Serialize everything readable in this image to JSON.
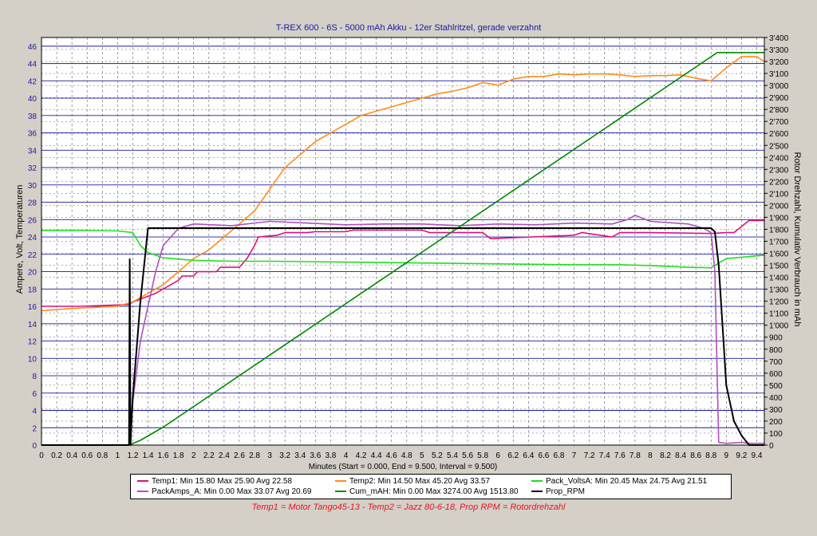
{
  "chart_data": {
    "type": "line",
    "title": "T-REX 600 - 6S - 5000 mAh Akku - 12er Stahlritzel, gerade verzahnt",
    "xlabel": "Minutes (Start = 0.000,  End = 9.500,  Interval =  9.500)",
    "ylabel_left": "Ampere, Volt, Temperaturen",
    "ylabel_right": "Rotor Drehzahl, Kumulativ Verbrauch in mAh",
    "xlim": [
      0,
      9.5
    ],
    "ylim_left": [
      0,
      47
    ],
    "ylim_right": [
      0,
      3400
    ],
    "grid": true,
    "x_ticks": [
      "0",
      "0.2",
      "0.4",
      "0.6",
      "0.8",
      "1",
      "1.2",
      "1.4",
      "1.6",
      "1.8",
      "2",
      "2.2",
      "2.4",
      "2.6",
      "2.8",
      "3",
      "3.2",
      "3.4",
      "3.6",
      "3.8",
      "4",
      "4.2",
      "4.4",
      "4.6",
      "4.8",
      "5",
      "5.2",
      "5.4",
      "5.6",
      "5.8",
      "6",
      "6.2",
      "6.4",
      "6.6",
      "6.8",
      "7",
      "7.2",
      "7.4",
      "7.6",
      "7.8",
      "8",
      "8.2",
      "8.4",
      "8.6",
      "8.8",
      "9",
      "9.2",
      "9.4"
    ],
    "y_left_ticks": [
      "0",
      "2",
      "4",
      "6",
      "8",
      "10",
      "12",
      "14",
      "16",
      "18",
      "20",
      "22",
      "24",
      "26",
      "28",
      "30",
      "32",
      "34",
      "36",
      "38",
      "40",
      "42",
      "44",
      "46"
    ],
    "y_right_ticks": [
      "0",
      "100",
      "200",
      "300",
      "400",
      "500",
      "600",
      "700",
      "800",
      "900",
      "1'000",
      "1'100",
      "1'200",
      "1'300",
      "1'400",
      "1'500",
      "1'600",
      "1'700",
      "1'800",
      "1'900",
      "2'000",
      "2'100",
      "2'200",
      "2'300",
      "2'400",
      "2'500",
      "2'600",
      "2'700",
      "2'800",
      "2'900",
      "3'000",
      "3'100",
      "3'200",
      "3'300",
      "3'400"
    ],
    "series": [
      {
        "name": "Temp1",
        "axis": "left",
        "color": "#e0107a",
        "x": [
          0,
          0.5,
          1.15,
          1.2,
          1.5,
          1.6,
          1.8,
          1.85,
          2.0,
          2.05,
          2.3,
          2.35,
          2.6,
          2.7,
          2.8,
          2.85,
          3.1,
          3.2,
          3.5,
          3.6,
          4.0,
          4.1,
          5.0,
          5.1,
          5.8,
          5.9,
          7.0,
          7.1,
          7.5,
          7.6,
          7.7,
          8.0,
          8.8,
          9.0,
          9.1,
          9.3,
          9.5
        ],
        "y": [
          16.0,
          16.0,
          16.2,
          16.5,
          17.5,
          18.0,
          19.0,
          19.5,
          19.5,
          20.0,
          20.0,
          20.5,
          20.5,
          21.5,
          23.0,
          24.0,
          24.2,
          24.5,
          24.5,
          24.6,
          24.6,
          24.8,
          24.8,
          24.5,
          24.5,
          23.8,
          24.2,
          24.5,
          24.0,
          24.5,
          24.5,
          24.5,
          24.4,
          24.5,
          24.5,
          25.9,
          25.9
        ]
      },
      {
        "name": "Temp2",
        "axis": "left",
        "color": "#ff8c1a",
        "x": [
          0,
          0.5,
          1.0,
          1.2,
          1.4,
          1.6,
          1.8,
          2.0,
          2.2,
          2.4,
          2.6,
          2.8,
          3.0,
          3.2,
          3.4,
          3.6,
          3.8,
          4.0,
          4.2,
          4.4,
          4.6,
          4.8,
          5.0,
          5.2,
          5.4,
          5.6,
          5.8,
          6.0,
          6.2,
          6.4,
          6.6,
          6.8,
          7.0,
          7.2,
          7.4,
          7.6,
          7.8,
          8.0,
          8.2,
          8.4,
          8.6,
          8.8,
          9.0,
          9.2,
          9.4,
          9.5
        ],
        "y": [
          15.5,
          15.8,
          16.0,
          16.5,
          17.5,
          18.5,
          20.0,
          21.5,
          22.5,
          24.0,
          25.5,
          27.0,
          29.5,
          32.0,
          33.5,
          35.0,
          36.0,
          37.0,
          38.0,
          38.5,
          39.0,
          39.5,
          40.0,
          40.5,
          40.8,
          41.2,
          41.8,
          41.5,
          42.2,
          42.5,
          42.5,
          42.8,
          42.7,
          42.8,
          42.8,
          42.7,
          42.5,
          42.6,
          42.6,
          42.7,
          42.3,
          42.0,
          43.5,
          44.8,
          44.8,
          44.2
        ]
      },
      {
        "name": "Pack_VoltsA",
        "axis": "left",
        "color": "#22dd22",
        "x": [
          0,
          0.5,
          1.0,
          1.2,
          1.3,
          1.4,
          1.6,
          2.0,
          2.5,
          3.0,
          4.0,
          5.0,
          6.0,
          7.0,
          7.6,
          8.0,
          8.5,
          8.8,
          9.0,
          9.5
        ],
        "y": [
          24.75,
          24.75,
          24.7,
          24.5,
          23.0,
          22.2,
          21.6,
          21.3,
          21.2,
          21.2,
          21.1,
          21.0,
          20.9,
          20.8,
          20.8,
          20.7,
          20.5,
          20.45,
          21.5,
          21.9
        ]
      },
      {
        "name": "PackAmps_A",
        "axis": "left",
        "color": "#b050c0",
        "x": [
          0,
          1.15,
          1.2,
          1.3,
          1.4,
          1.5,
          1.6,
          1.7,
          1.8,
          2.0,
          2.5,
          3.0,
          3.5,
          4.0,
          4.5,
          5.0,
          5.5,
          6.0,
          6.5,
          7.0,
          7.5,
          7.7,
          7.8,
          8.0,
          8.5,
          8.7,
          8.8,
          8.85,
          8.9,
          9.0,
          9.2,
          9.3,
          9.5
        ],
        "y": [
          0,
          0,
          5,
          12,
          16,
          20,
          23,
          24,
          25,
          25.5,
          25.3,
          25.8,
          25.6,
          25.4,
          25.5,
          25.5,
          25.3,
          25.5,
          25.4,
          25.6,
          25.5,
          26.0,
          26.5,
          25.8,
          25.5,
          25.0,
          24.5,
          20.0,
          0.3,
          0.2,
          0.3,
          0.2,
          0.2
        ]
      },
      {
        "name": "Cum_mAH",
        "axis": "right",
        "color": "#008800",
        "x": [
          0,
          1.15,
          1.3,
          1.6,
          8.88,
          9.0,
          9.5
        ],
        "y": [
          0,
          0,
          40,
          150,
          3274,
          3274,
          3274
        ]
      },
      {
        "name": "Prop_RPM",
        "axis": "right",
        "color": "#000000",
        "x": [
          0,
          1.15,
          1.16,
          1.17,
          1.18,
          1.2,
          1.3,
          1.4,
          1.5,
          8.8,
          8.85,
          8.9,
          9.0,
          9.1,
          9.2,
          9.3,
          9.5
        ],
        "y": [
          0,
          0,
          1550,
          0,
          150,
          400,
          1200,
          1810,
          1810,
          1810,
          1780,
          1500,
          500,
          200,
          80,
          0,
          0
        ]
      }
    ],
    "legend_text": {
      "temp1": "Temp1:  Min 15.80 Max 25.90 Avg 22.58",
      "temp2": "Temp2:  Min 14.50 Max 45.20 Avg 33.57",
      "volts": "Pack_VoltsA:  Min 20.45 Max 24.75 Avg 21.51",
      "amps": "PackAmps_A:  Min 0.00 Max 33.07 Avg 20.69",
      "cum": "Cum_mAH:  Min 0.00 Max 3274.00 Avg 1513.80",
      "rpm": "Prop_RPM"
    },
    "legend_placement": "bottom",
    "subtitle": "Temp1 = Motor Tango45-13 - Temp2 = Jazz 80-6-18, Prop RPM = Rotordrehzahl"
  },
  "colors": {
    "background": "#d4d0c8",
    "plot_bg": "#ffffff",
    "grid_major": "#1a1aa0",
    "grid_minor": "#606060",
    "title_text": "#1a1aa0",
    "subtitle_text": "#e8141e"
  }
}
